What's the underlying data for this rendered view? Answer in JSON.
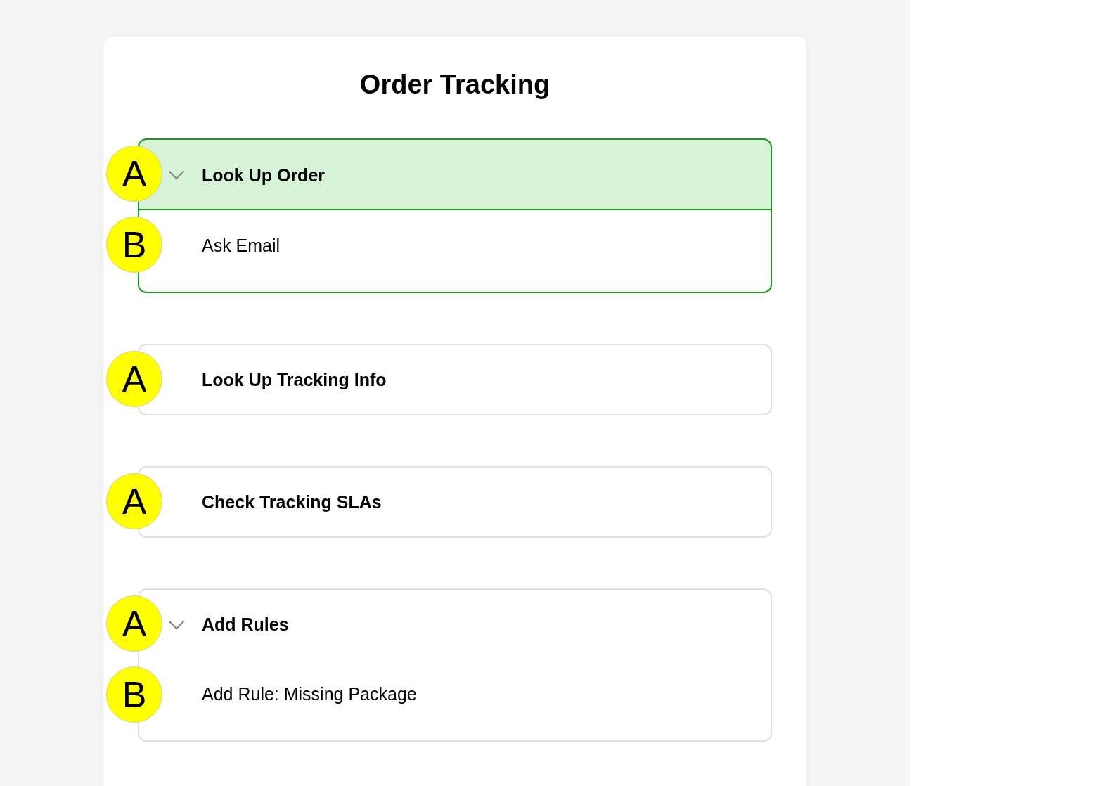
{
  "title": "Order Tracking",
  "groups": [
    {
      "badge": "A",
      "label": "Look Up Order",
      "selected": true,
      "expanded": true,
      "children": [
        {
          "badge": "B",
          "label": "Ask Email"
        }
      ]
    },
    {
      "badge": "A",
      "label": "Look Up Tracking Info",
      "selected": false
    },
    {
      "badge": "A",
      "label": "Check Tracking SLAs",
      "selected": false
    },
    {
      "badge": "A",
      "label": "Add Rules",
      "selected": false,
      "expanded": true,
      "children": [
        {
          "badge": "B",
          "label": "Add Rule: Missing Package"
        }
      ]
    }
  ]
}
